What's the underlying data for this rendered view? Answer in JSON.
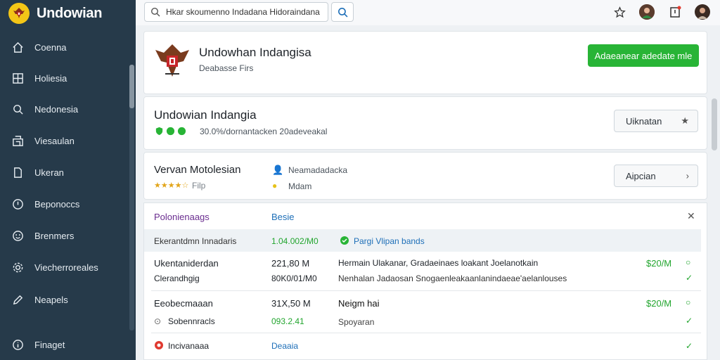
{
  "app": {
    "title": "Undowian"
  },
  "sidebar": {
    "items": [
      {
        "label": "Coenna",
        "icon": "home-icon"
      },
      {
        "label": "Holiesia",
        "icon": "grid-icon"
      },
      {
        "label": "Nedonesia",
        "icon": "search-icon"
      },
      {
        "label": "Viesaulan",
        "icon": "building-icon"
      },
      {
        "label": "Ukeran",
        "icon": "document-icon"
      },
      {
        "label": "Beponoccs",
        "icon": "compass-icon"
      },
      {
        "label": "Brenmers",
        "icon": "smiley-icon"
      },
      {
        "label": "Viecherroreales",
        "icon": "gear-icon"
      },
      {
        "label": "Neapels",
        "icon": "edit-icon"
      },
      {
        "label": "Finaget",
        "icon": "info-icon"
      }
    ]
  },
  "search": {
    "value": "Hkar skoumenno Indadana Hidoraindana"
  },
  "header_card": {
    "title": "Undowhan Indangisa",
    "subtitle": "Deabasse Firs",
    "action_label": "Adaeanear adedate mle"
  },
  "card2": {
    "title": "Undowian Indangia",
    "meta": "30.0%/dornantacken 20adeveakal",
    "button_label": "Uiknatan"
  },
  "card3": {
    "title": "Vervan Motolesian",
    "rating_label": "Filp",
    "info1": "Neamadadacka",
    "info2": "Mdam",
    "button_label": "Aipcian"
  },
  "table": {
    "tabs": [
      "Polonienaags",
      "Besie"
    ],
    "summary": {
      "label": "Ekerantdmn Innadaris",
      "value": "1.04.002/M0",
      "link": "Pargi Vlipan bands"
    },
    "rows": [
      {
        "name": "Ukentaniderdan",
        "sub": "Clerandhgig",
        "amount": "221,80 M",
        "amount2": "80K0/01/M0",
        "desc": "Hermain Ulakanar, Gradaeinaes loakant Joelanotkain",
        "desc2": "Nenhalan Jadaosan Snogaenleakaanlanindaeae'aelanlouses",
        "price": "$20/M"
      },
      {
        "name": "Eeobecmaaan",
        "sub": "Sobennracls",
        "amount": "31X,50 M",
        "amount2": "093.2.41",
        "desc": "Neigm hai",
        "desc2": "Spoyaran",
        "price": "$20/M"
      },
      {
        "name": "Incivanaaa",
        "sub": "",
        "amount": "Deaaia",
        "amount2": "",
        "desc": "",
        "desc2": "",
        "price": ""
      }
    ]
  },
  "colors": {
    "sidebar": "#263a4a",
    "accent_green": "#28b436",
    "link_blue": "#1e6fb8"
  }
}
